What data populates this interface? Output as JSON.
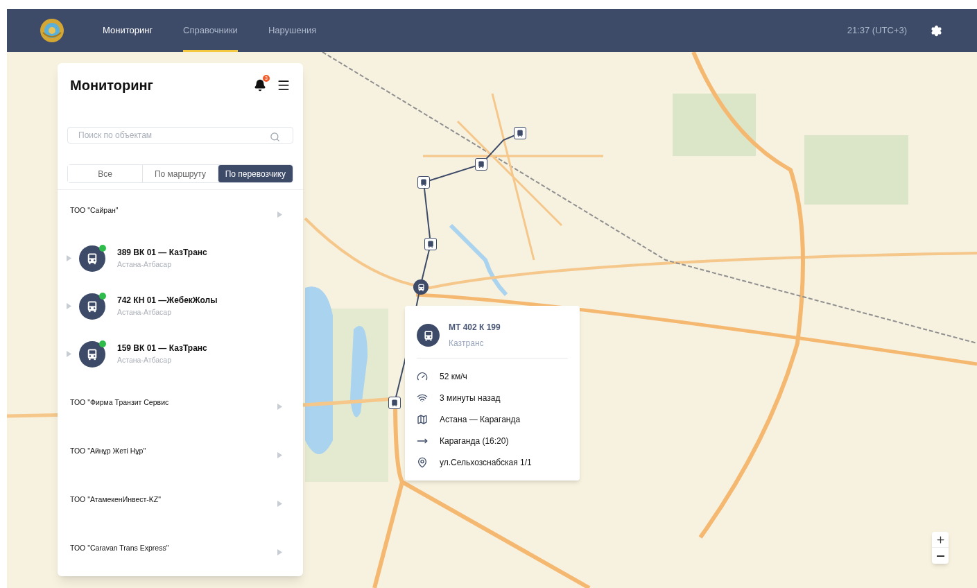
{
  "header": {
    "nav": [
      {
        "label": "Мониторинг",
        "selected": false,
        "current": true
      },
      {
        "label": "Справочники",
        "selected": true,
        "current": false
      },
      {
        "label": "Нарушения",
        "selected": false,
        "current": false
      }
    ],
    "time": "21:37 (UTC+3)"
  },
  "panel": {
    "title": "Мониторинг",
    "notification_count": "3",
    "search": {
      "placeholder": "Поиск по объектам"
    },
    "filters": [
      {
        "label": "Все",
        "selected": false
      },
      {
        "label": "По маршруту",
        "selected": false
      },
      {
        "label": "По перевозчику",
        "selected": true
      }
    ],
    "carriers": [
      {
        "name": "ТОО \"Сайран\"",
        "children": [
          {
            "title": "389 ВК 01 — КазТранс",
            "route": "Астана-Атбасар",
            "online": true
          },
          {
            "title": "742 КН 01 —ЖебекЖолы",
            "route": "Астана-Атбасар",
            "online": true
          },
          {
            "title": "159 ВК 01 — КазТранс",
            "route": "Астана-Атбасар",
            "online": true
          }
        ]
      },
      {
        "name": "ТОО \"Фирма Транзит Сервис"
      },
      {
        "name": "ТОО \"Айнұр Жеті Нұр\""
      },
      {
        "name": "ТОО \"АтамекенИнвест-KZ\""
      },
      {
        "name": "ТОО \"Caravan Trans Express\""
      }
    ]
  },
  "popup": {
    "plate": "МТ 402 К 199",
    "carrier": "Казтранс",
    "rows": [
      {
        "kind": "speed",
        "text": "52 км/ч"
      },
      {
        "kind": "signal",
        "text": "3 минуты назад"
      },
      {
        "kind": "route",
        "text": "Астана — Караганда"
      },
      {
        "kind": "destination",
        "text": "Караганда (16:20)"
      },
      {
        "kind": "address",
        "text": "ул.Сельхозснабская 1/1"
      }
    ]
  }
}
